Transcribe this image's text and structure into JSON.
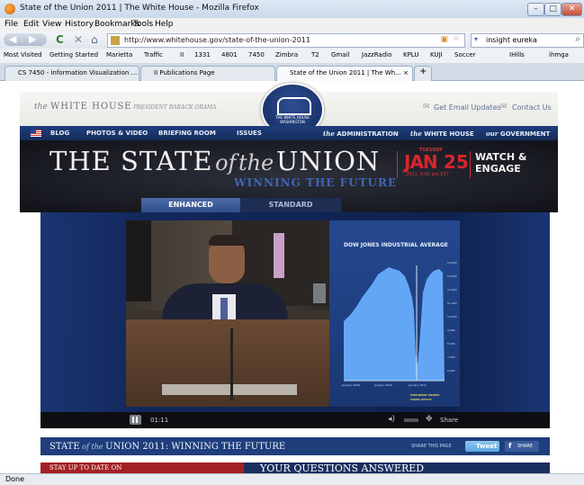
{
  "window": {
    "title": "State of the Union 2011 | The White House - Mozilla Firefox"
  },
  "menu": [
    "File",
    "Edit",
    "View",
    "History",
    "Bookmarks",
    "Tools",
    "Help"
  ],
  "address": {
    "url": "http://www.whitehouse.gov/state-of-the-union-2011",
    "search_value": "insight eureka"
  },
  "bookmarks": [
    "Most Visited",
    "Getting Started",
    "Marietta",
    "Traffic",
    "II",
    "1331",
    "4801",
    "7450",
    "Zimbra",
    "T2",
    "Gmail",
    "JazzRadio",
    "KPLU",
    "KUJI",
    "Soccer",
    "IHills",
    "ihmga"
  ],
  "tabs": [
    {
      "label": "CS 7450 - Information Visualization ..."
    },
    {
      "label": "II Publications Page"
    },
    {
      "label": "State of the Union 2011 | The Wh..."
    }
  ],
  "wh_header": {
    "left_italic": "the",
    "left_main": "WHITE HOUSE",
    "left_sub": "PRESIDENT BARACK OBAMA",
    "seal_text": "THE WHITE HOUSE WASHINGTON",
    "email": "Get Email Updates",
    "contact": "Contact Us"
  },
  "nav": [
    "BLOG",
    "PHOTOS & VIDEO",
    "BRIEFING ROOM",
    "ISSUES"
  ],
  "nav_right": [
    {
      "it": "the",
      "txt": "ADMINISTRATION"
    },
    {
      "it": "the",
      "txt": "WHITE HOUSE"
    },
    {
      "it": "our",
      "txt": "GOVERNMENT"
    }
  ],
  "hero": {
    "title_a": "THE STATE",
    "title_of": "of",
    "title_the": "the",
    "title_b": "UNION",
    "subtitle": "WINNING THE FUTURE",
    "date_day": "TUESDAY",
    "date_month": "JAN",
    "date_num": "25",
    "date_time": "2011, 9:00 pm EST",
    "watch": "WATCH &",
    "engage": "ENGAGE"
  },
  "view_tabs": {
    "enhanced": "ENHANCED",
    "standard": "STANDARD"
  },
  "chart": {
    "title": "DOW JONES INDUSTRIAL AVERAGE",
    "yticks": [
      "14,000",
      "13,000",
      "12,000",
      "11,000",
      "10,000",
      "9,000",
      "8,000",
      "7,000",
      "6,000"
    ],
    "xticks": [
      "January 2009",
      "January 2010",
      "January 2011"
    ],
    "note1": "PRESIDENT OBAMA",
    "note2": "TAKES OFFICE"
  },
  "player": {
    "time": "01:11",
    "share": "Share"
  },
  "footer": {
    "title_a": "STATE",
    "title_of": "of",
    "title_the": "the",
    "title_b": "UNION 2011: WINNING THE FUTURE",
    "share_label": "SHARE THIS PAGE",
    "tweet": "Tweet",
    "fb": "SHARE",
    "left_teaser": "STAY UP TO DATE ON",
    "right_teaser": "YOUR QUESTIONS ANSWERED"
  },
  "status": "Done"
}
